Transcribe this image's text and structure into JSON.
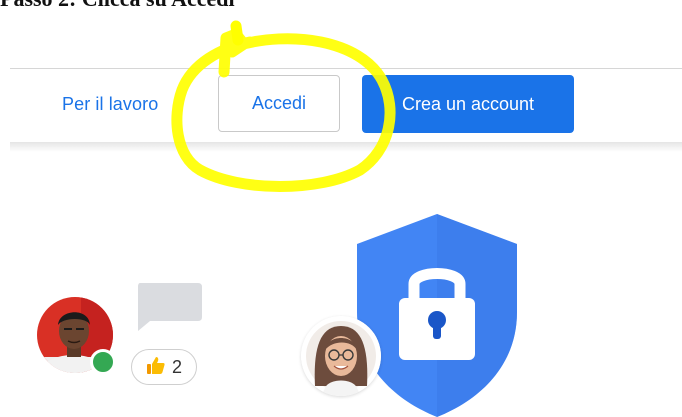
{
  "caption": "Passo 2: Clicca su Accedi",
  "header": {
    "work_link": "Per il lavoro",
    "signin_button": "Accedi",
    "create_account_button": "Crea un account"
  },
  "social": {
    "like_count": "2"
  },
  "colors": {
    "brand_blue": "#1a73e8",
    "shield_blue": "#4285f4",
    "highlight_yellow": "#ffff00",
    "online_green": "#34a853"
  },
  "icons": {
    "lock": "lock-icon",
    "thumbs_up": "thumbs-up-icon",
    "chat": "chat-bubble-icon"
  }
}
